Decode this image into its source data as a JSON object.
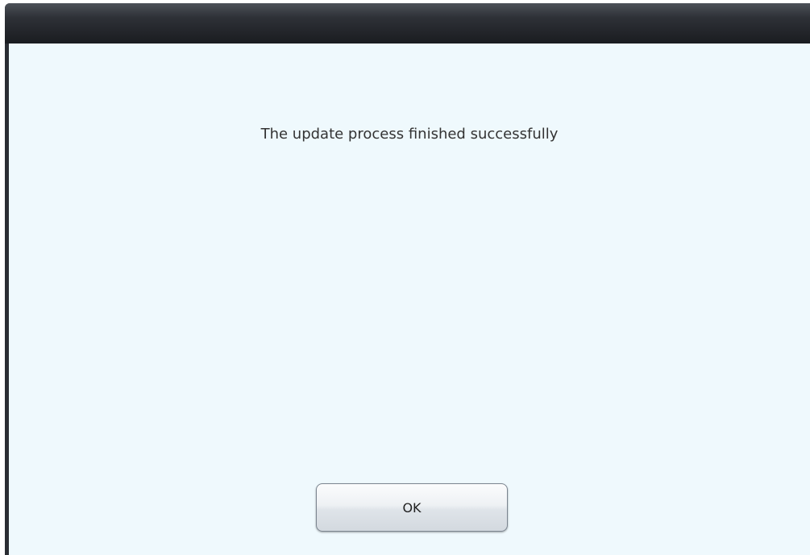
{
  "dialog": {
    "message": "The update process finished successfully",
    "ok_label": "OK"
  }
}
